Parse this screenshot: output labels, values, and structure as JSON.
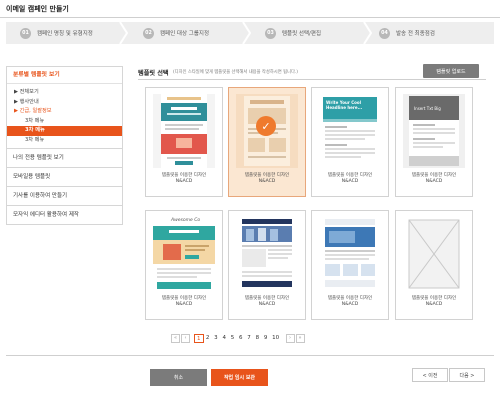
{
  "page_title": "이메일 캠페인 만들기",
  "steps": [
    {
      "num": "01",
      "label": "캠페인 명칭 및 유형지정"
    },
    {
      "num": "02",
      "label": "캠페인 대상 그룹지정"
    },
    {
      "num": "03",
      "label": "템플릿 선택/편집"
    },
    {
      "num": "04",
      "label": "발송 전 최종점검"
    }
  ],
  "sidebar": {
    "header": "분류별 템플릿 보기",
    "tree": [
      {
        "label": "▶ 전체보기"
      },
      {
        "label": "▶ 행사안내"
      },
      {
        "label": "▶ 긴급, 일괄정보"
      },
      {
        "label": "3차 메뉴"
      },
      {
        "label": "3차 메뉴"
      },
      {
        "label": "3차 메뉴"
      }
    ],
    "menus": [
      "나의 전용 템플릿 보기",
      "모바일용 템플릿",
      "기사를 이용하여 만들기",
      "모자익 에디터 활용하여 제작"
    ]
  },
  "main": {
    "title": "템플릿 선택",
    "description": "(디자인 스타일에 맞게 템플릿을 선택해서 내용을 작성하시면 됩니다.)",
    "upload_label": "템플릿 업로드"
  },
  "templates": [
    {
      "line1": "템플릿을 이용한 디자인",
      "line2": "N&ACD",
      "selected": false
    },
    {
      "line1": "템플릿을 이용한 디자인",
      "line2": "N&ACD",
      "selected": true
    },
    {
      "line1": "템플릿을 이용한 디자인",
      "line2": "N&ACD",
      "selected": false
    },
    {
      "line1": "템플릿을 이용한 디자인",
      "line2": "N&ACD",
      "selected": false
    },
    {
      "line1": "템플릿을 이용한 디자인",
      "line2": "N&ACD",
      "selected": false
    },
    {
      "line1": "템플릿을 이용한 디자인",
      "line2": "N&ACD",
      "selected": false
    },
    {
      "line1": "템플릿을 이용한 디자인",
      "line2": "N&ACD",
      "selected": false
    },
    {
      "line1": "템플릿을 이용한 디자인",
      "line2": "N&ACD",
      "selected": false
    }
  ],
  "thumb_text": {
    "t3_header": "Write Your Cool Headline here...",
    "t4_banner": "Insert Txt Big",
    "t5_brand": "Awesome Co"
  },
  "pagination": {
    "first": "«",
    "prev": "‹",
    "pages": [
      "1",
      "2",
      "3",
      "4",
      "5",
      "6",
      "7",
      "8",
      "9",
      "10"
    ],
    "current": "1",
    "next": "›",
    "last": "»"
  },
  "buttons": {
    "cancel": "취소",
    "save": "작업 임시 보관",
    "prev": "< 이전",
    "next": "다음 >"
  },
  "colors": {
    "accent": "#e8541b",
    "selected_card_bg": "#fbe7d2",
    "gray_button": "#7b7b7b"
  }
}
